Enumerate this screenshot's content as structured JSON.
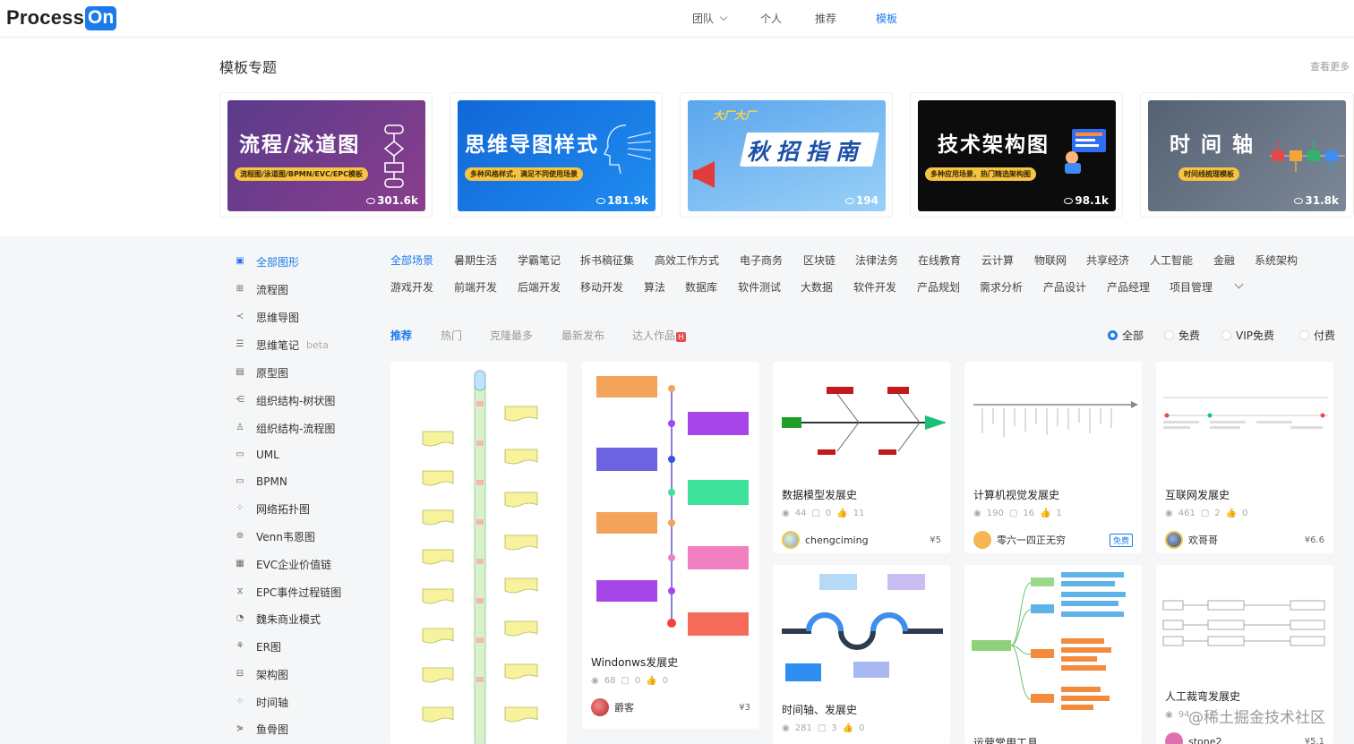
{
  "header": {
    "logo_text": "Process",
    "logo_badge": "On",
    "nav": [
      {
        "label": "团队",
        "has_dropdown": true
      },
      {
        "label": "个人"
      },
      {
        "label": "推荐"
      },
      {
        "label": "模板",
        "active": true
      }
    ]
  },
  "featured": {
    "title": "模板专题",
    "view_more": "查看更多",
    "cards": [
      {
        "title": "流程/泳道图",
        "subtitle": "流程图/泳道图/BPMN/EVC/EPC模板",
        "views": "301.6k",
        "bg": "#5b3b8c"
      },
      {
        "title": "思维导图样式",
        "subtitle": "多种风格样式，满足不同使用场景",
        "views": "181.9k",
        "bg": "#1677e6"
      },
      {
        "title": "秋招指南",
        "subtitle": "大厂大厂",
        "views": "194",
        "bg": "#74b6f0"
      },
      {
        "title": "技术架构图",
        "subtitle": "多种应用场景，热门精选架构图",
        "views": "98.1k",
        "bg": "#0c0c0c"
      },
      {
        "title": "时 间 轴",
        "subtitle": "时间线梳理模板",
        "views": "31.8k",
        "bg": "#5b6778"
      }
    ]
  },
  "sidebar": {
    "items": [
      {
        "label": "全部图形",
        "icon": "layers-icon",
        "active": true
      },
      {
        "label": "流程图",
        "icon": "flowchart-icon"
      },
      {
        "label": "思维导图",
        "icon": "mindmap-icon"
      },
      {
        "label": "思维笔记",
        "icon": "list-icon",
        "badge": "beta"
      },
      {
        "label": "原型图",
        "icon": "prototype-icon"
      },
      {
        "label": "组织结构-树状图",
        "icon": "tree-icon"
      },
      {
        "label": "组织结构-流程图",
        "icon": "org-icon"
      },
      {
        "label": "UML",
        "icon": "uml-icon"
      },
      {
        "label": "BPMN",
        "icon": "bpmn-icon"
      },
      {
        "label": "网络拓扑图",
        "icon": "network-icon"
      },
      {
        "label": "Venn韦恩图",
        "icon": "venn-icon"
      },
      {
        "label": "EVC企业价值链",
        "icon": "evc-icon"
      },
      {
        "label": "EPC事件过程链图",
        "icon": "epc-icon"
      },
      {
        "label": "魏朱商业模式",
        "icon": "pie-icon"
      },
      {
        "label": "ER图",
        "icon": "er-icon"
      },
      {
        "label": "架构图",
        "icon": "architecture-icon"
      },
      {
        "label": "时间轴",
        "icon": "timeline-icon"
      },
      {
        "label": "鱼骨图",
        "icon": "fishbone-icon"
      }
    ]
  },
  "categories": {
    "row1": [
      "全部场景",
      "暑期生活",
      "学霸笔记",
      "拆书稿征集",
      "高效工作方式",
      "电子商务",
      "区块链",
      "法律法务",
      "在线教育",
      "云计算",
      "物联网",
      "共享经济",
      "人工智能",
      "金融",
      "系统架构"
    ],
    "row2": [
      "游戏开发",
      "前端开发",
      "后端开发",
      "移动开发",
      "算法",
      "数据库",
      "软件测试",
      "大数据",
      "软件开发",
      "产品规划",
      "需求分析",
      "产品设计",
      "产品经理",
      "项目管理"
    ]
  },
  "sort_tabs": [
    "推荐",
    "热门",
    "克隆最多",
    "最新发布",
    "达人作品"
  ],
  "hot_badge": "H",
  "price_filter": [
    "全部",
    "免费",
    "VIP免费",
    "付费"
  ],
  "templates": [
    {
      "name": "数据模型发展史",
      "views": "44",
      "clones": "0",
      "likes": "11",
      "author": "chengciming",
      "price": "¥5"
    },
    {
      "name": "计算机视觉发展史",
      "views": "190",
      "clones": "16",
      "likes": "1",
      "author": "零六一四正无穷",
      "price_tag": "免费"
    },
    {
      "name": "互联网发展史",
      "views": "461",
      "clones": "2",
      "likes": "0",
      "author": "欢哥哥",
      "price": "¥6.6"
    },
    {
      "name": "Windonws发展史",
      "views": "68",
      "clones": "0",
      "likes": "0",
      "author": "爵客",
      "price": "¥3"
    },
    {
      "name": "时间轴、发展史",
      "views": "281",
      "clones": "3",
      "likes": "0"
    },
    {
      "name": "运营常用工具"
    },
    {
      "name": "人工裁弯发展史",
      "views": "94",
      "author": "stone2",
      "price": "¥5.1"
    }
  ],
  "watermark": "@稀土掘金技术社区"
}
